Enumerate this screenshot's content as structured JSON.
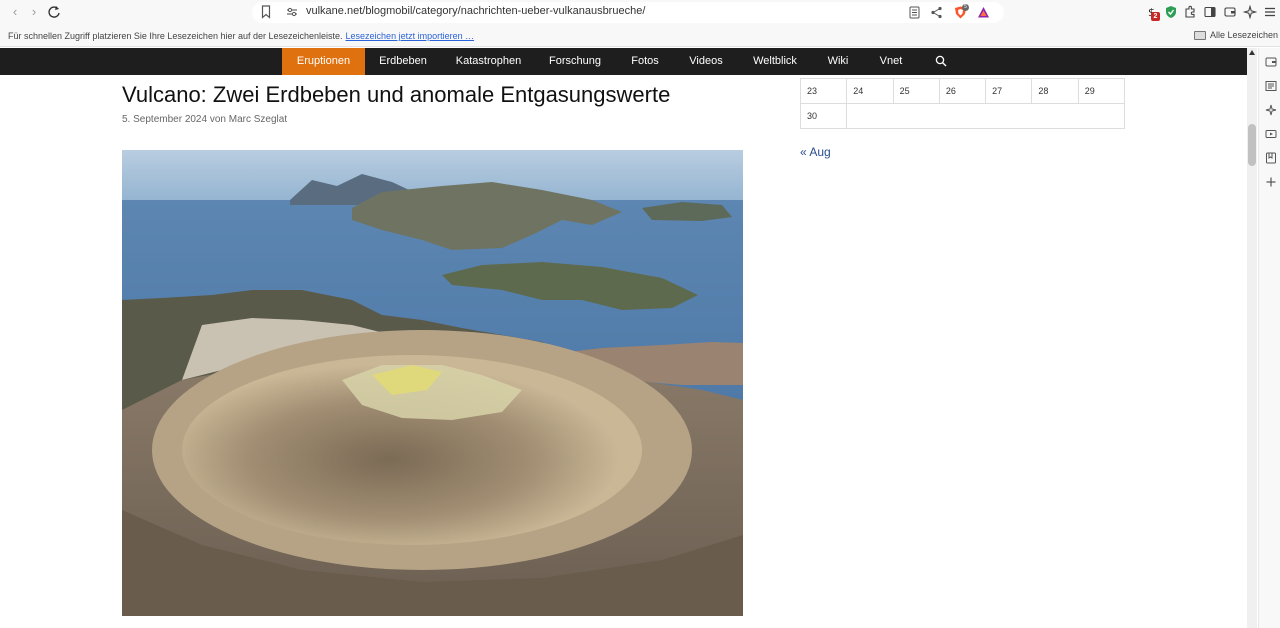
{
  "browser": {
    "url": "vulkane.net/blogmobil/category/nachrichten-ueber-vulkanausbrueche/",
    "extension_badge": "2",
    "brave_badge": "5"
  },
  "bookmarks_bar": {
    "hint": "Für schnellen Zugriff platzieren Sie Ihre Lesezeichen hier auf der Lesezeichenleiste.",
    "import_link": "Lesezeichen jetzt importieren …",
    "all_bookmarks": "Alle Lesezeichen"
  },
  "site_nav": {
    "items": [
      "Eruptionen",
      "Erdbeben",
      "Katastrophen",
      "Forschung",
      "Fotos",
      "Videos",
      "Weltblick",
      "Wiki",
      "Vnet"
    ],
    "active_index": 0,
    "accent_color": "#e0710f",
    "background_color": "#1e1e1e"
  },
  "article": {
    "title": "Vulcano: Zwei Erdbeben und anomale Entgasungswerte",
    "meta": "5. September 2024 von Marc Szeglat"
  },
  "calendar": {
    "rows": [
      [
        "23",
        "24",
        "25",
        "26",
        "27",
        "28",
        "29"
      ],
      [
        "30"
      ]
    ],
    "prev_link": "« Aug"
  }
}
